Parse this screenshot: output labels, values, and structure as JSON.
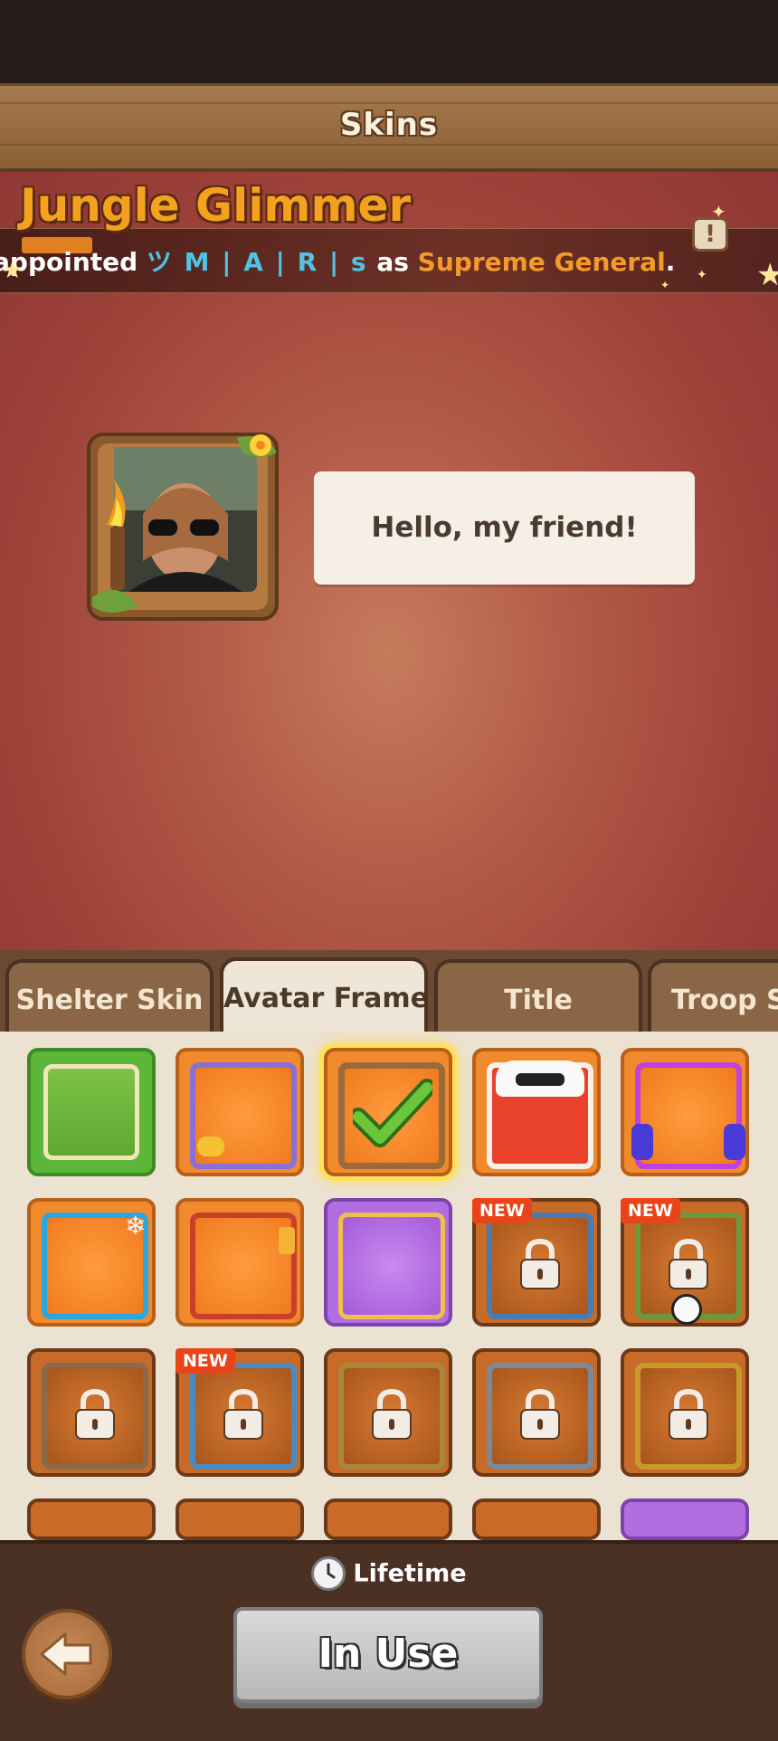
{
  "header": {
    "title": "Skins"
  },
  "preview": {
    "skin_name": "Jungle Glimmer",
    "announcement": {
      "prefix": "appointed ",
      "player_name": "ツ M | A | R | s",
      "middle": " as ",
      "rank": "Supreme General",
      "suffix": "."
    },
    "info_icon": "!",
    "speech_bubble": "Hello, my friend!"
  },
  "tabs": [
    {
      "label": "Shelter Skin",
      "active": false
    },
    {
      "label": "Avatar Frame",
      "active": true
    },
    {
      "label": "Title",
      "active": false
    },
    {
      "label": "Troop S",
      "active": false
    }
  ],
  "frames": {
    "new_label": "NEW",
    "items": [
      {
        "style": "green",
        "locked": false,
        "new": false,
        "selected": false
      },
      {
        "style": "orange",
        "locked": false,
        "new": false,
        "selected": false
      },
      {
        "style": "orange",
        "locked": false,
        "new": false,
        "selected": true
      },
      {
        "style": "orange",
        "locked": false,
        "new": false,
        "selected": false
      },
      {
        "style": "orange",
        "locked": false,
        "new": false,
        "selected": false
      },
      {
        "style": "orange",
        "locked": false,
        "new": false,
        "selected": false
      },
      {
        "style": "orange",
        "locked": false,
        "new": false,
        "selected": false
      },
      {
        "style": "purple",
        "locked": false,
        "new": false,
        "selected": false
      },
      {
        "style": "locked",
        "locked": true,
        "new": true,
        "selected": false
      },
      {
        "style": "locked",
        "locked": true,
        "new": true,
        "selected": false
      },
      {
        "style": "locked",
        "locked": true,
        "new": false,
        "selected": false
      },
      {
        "style": "locked",
        "locked": true,
        "new": true,
        "selected": false
      },
      {
        "style": "locked",
        "locked": true,
        "new": false,
        "selected": false
      },
      {
        "style": "locked",
        "locked": true,
        "new": false,
        "selected": false
      },
      {
        "style": "locked",
        "locked": true,
        "new": false,
        "selected": false
      }
    ]
  },
  "footer": {
    "duration": "Lifetime",
    "action_label": "In Use"
  },
  "colors": {
    "accent_orange": "#f49a2a",
    "player_name_blue": "#4fc3e3",
    "new_badge": "#e94419"
  }
}
